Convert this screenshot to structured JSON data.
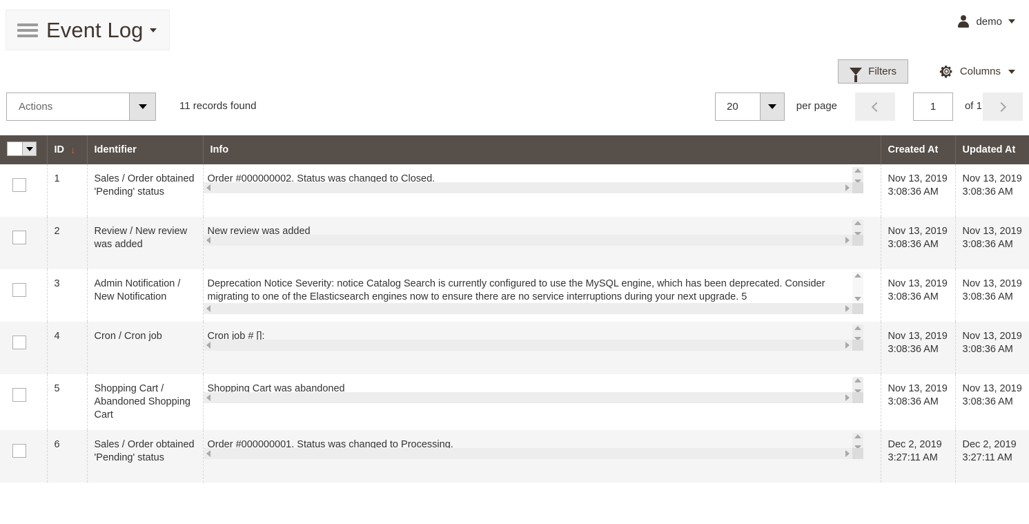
{
  "header": {
    "title": "Event Log",
    "menu_icon": "hamburger-icon",
    "title_caret_icon": "caret-down-icon",
    "user": {
      "name": "demo",
      "avatar_icon": "user-avatar-icon",
      "caret_icon": "caret-down-icon"
    }
  },
  "toolbar": {
    "filters_label": "Filters",
    "filters_icon": "funnel-icon",
    "columns_label": "Columns",
    "columns_icon": "gear-icon",
    "columns_caret_icon": "caret-down-icon"
  },
  "actionbar": {
    "actions_label": "Actions",
    "actions_caret_icon": "caret-down-icon",
    "records_found": "11 records found",
    "per_page_value": "20",
    "per_page_caret_icon": "caret-down-icon",
    "per_page_label": "per page",
    "prev_icon": "chevron-left-icon",
    "next_icon": "chevron-right-icon",
    "page_value": "1",
    "page_total": "of 1"
  },
  "table": {
    "select_all_icon": "checkbox-dropdown-icon",
    "columns": [
      {
        "key": "check",
        "label": ""
      },
      {
        "key": "id",
        "label": "ID",
        "sort": "desc",
        "sort_icon": "arrow-down-icon"
      },
      {
        "key": "identifier",
        "label": "Identifier"
      },
      {
        "key": "info",
        "label": "Info"
      },
      {
        "key": "created",
        "label": "Created At"
      },
      {
        "key": "updated",
        "label": "Updated At"
      }
    ],
    "rows": [
      {
        "id": "1",
        "identifier": "Sales / Order obtained 'Pending' status",
        "info": "Order #000000002. Status was changed to Closed.",
        "created_at": "Nov 13, 2019 3:08:36 AM",
        "updated_at": "Nov 13, 2019 3:08:36 AM",
        "info_lines": 1
      },
      {
        "id": "2",
        "identifier": "Review / New review was added",
        "info": "New review was added",
        "created_at": "Nov 13, 2019 3:08:36 AM",
        "updated_at": "Nov 13, 2019 3:08:36 AM",
        "info_lines": 1
      },
      {
        "id": "3",
        "identifier": "Admin Notification / New Notification",
        "info": "Deprecation Notice Severity: notice Catalog Search is currently configured to use the MySQL engine, which has been deprecated. Consider migrating to one of the Elasticsearch engines now to ensure there are no service interruptions during your next upgrade. 5",
        "created_at": "Nov 13, 2019 3:08:36 AM",
        "updated_at": "Nov 13, 2019 3:08:36 AM",
        "info_lines": 2
      },
      {
        "id": "4",
        "identifier": "Cron / Cron job",
        "info": "Cron job # []:",
        "created_at": "Nov 13, 2019 3:08:36 AM",
        "updated_at": "Nov 13, 2019 3:08:36 AM",
        "info_lines": 1
      },
      {
        "id": "5",
        "identifier": "Shopping Cart / Abandoned Shopping Cart",
        "info": "Shopping Cart was abandoned",
        "created_at": "Nov 13, 2019 3:08:36 AM",
        "updated_at": "Nov 13, 2019 3:08:36 AM",
        "info_lines": 1
      },
      {
        "id": "6",
        "identifier": "Sales / Order obtained 'Pending' status",
        "info": "Order #000000001. Status was changed to Processing.",
        "created_at": "Dec 2, 2019 3:27:11 AM",
        "updated_at": "Dec 2, 2019 3:27:11 AM",
        "info_lines": 1
      }
    ]
  },
  "colors": {
    "header_bg": "#564f4a",
    "sort_arrow": "#d8604f",
    "alt_row": "#f5f5f5",
    "title_text": "#41362f"
  }
}
